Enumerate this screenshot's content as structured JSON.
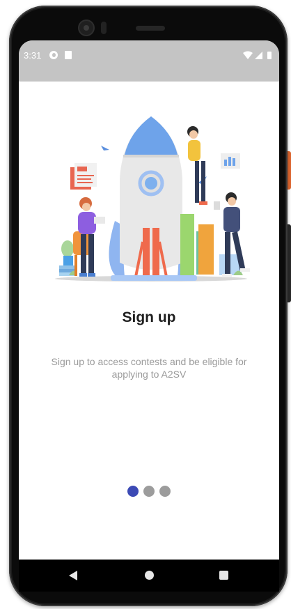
{
  "status_bar": {
    "time": "3:31",
    "icons_left": [
      "sync-icon",
      "sd-card-icon"
    ],
    "icons_right": [
      "wifi-icon",
      "cell-signal-icon",
      "battery-icon"
    ],
    "background_color": "#c4c4c4"
  },
  "onboarding": {
    "title": "Sign up",
    "description": "Sign up to access contests and be eligible for applying to A2SV",
    "page_indicator": {
      "total": 3,
      "current": 1,
      "active_color": "#3c4ab5",
      "inactive_color": "#9c9c9c"
    },
    "illustration": "rocket-launch-team-illustration"
  },
  "nav_bar": {
    "buttons": [
      "back-icon",
      "home-icon",
      "recents-icon"
    ]
  }
}
